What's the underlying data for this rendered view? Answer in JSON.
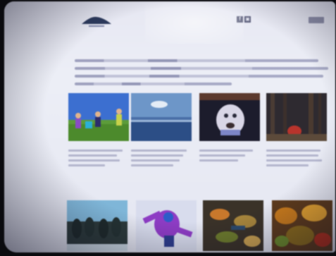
{
  "brand": {
    "logo_icon": "mountain-logo-icon"
  },
  "header": {
    "social_icons": [
      "facebook-icon",
      "instagram-icon"
    ],
    "social_glyphs": [
      "f",
      "▣"
    ],
    "search_placeholder": "",
    "search_button": ""
  },
  "nav": {
    "items": [
      "",
      "",
      "",
      "",
      "",
      "",
      "",
      "",
      "",
      ""
    ]
  },
  "main": {
    "headline": "",
    "intro_lines": 4
  },
  "cards": [
    {
      "title": "",
      "scene": "kids-playing-outdoors"
    },
    {
      "title": "",
      "scene": "lake-and-sky"
    },
    {
      "title": "",
      "scene": "dog-close-up"
    },
    {
      "title": "",
      "scene": "forest-path"
    },
    {
      "title": "",
      "scene": "group-of-people"
    },
    {
      "title": "",
      "scene": "child-in-purple-snowsuit"
    },
    {
      "title": "",
      "scene": "autumn-leaves"
    },
    {
      "title": "",
      "scene": "fall-foliage"
    }
  ],
  "colors": {
    "page_bg": "#e9eaf4",
    "accent": "#3c3f78",
    "nav_text": "#7a7da0"
  }
}
